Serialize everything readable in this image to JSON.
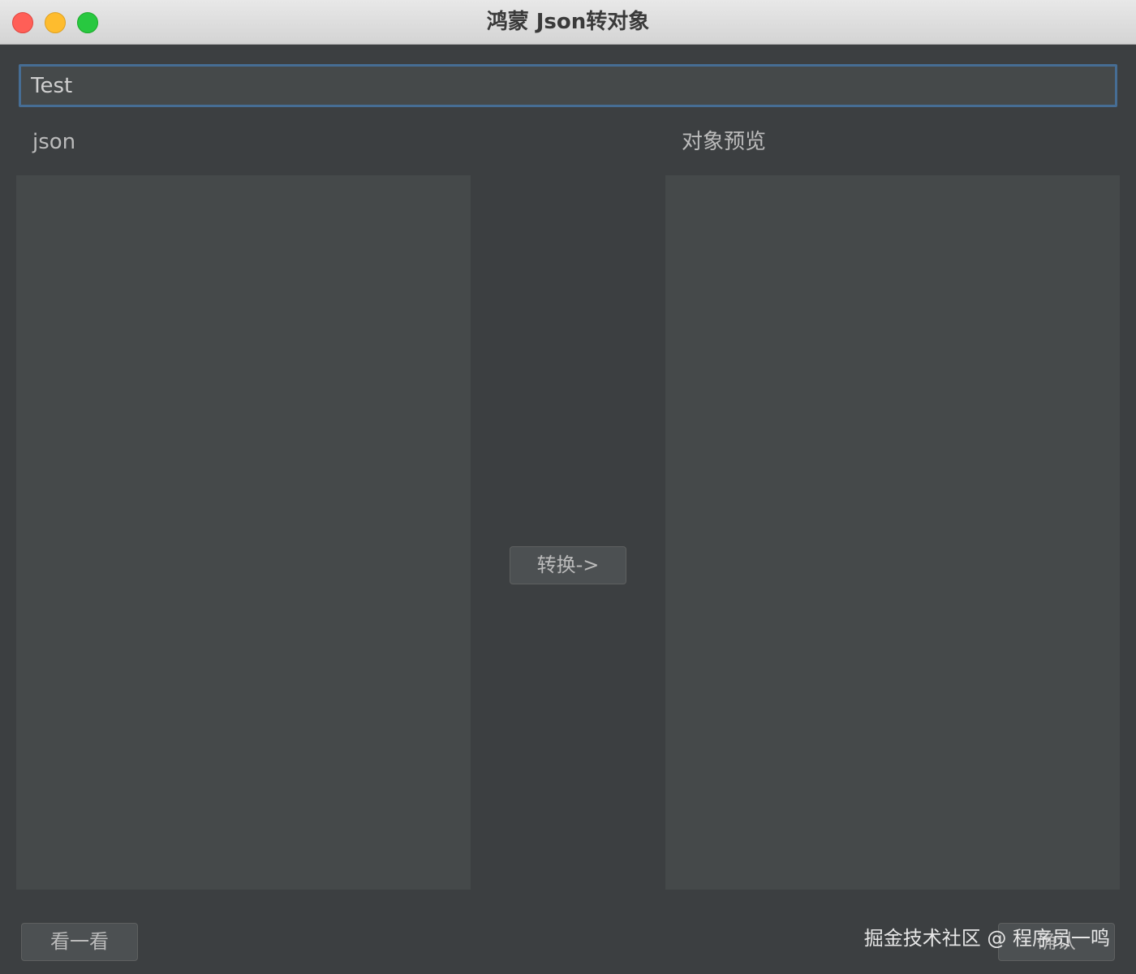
{
  "window": {
    "title": "鸿蒙 Json转对象"
  },
  "form": {
    "name_value": "Test",
    "json_label": "json",
    "json_text": "",
    "preview_label": "对象预览",
    "preview_text": ""
  },
  "buttons": {
    "convert_label": "转换->",
    "look_label": "看一看",
    "confirm_label": "确认"
  },
  "watermark": {
    "text": "掘金技术社区 @ 程序员一鸣"
  },
  "colors": {
    "background": "#3c3f41",
    "field": "#45494a",
    "focus_border": "#466d94",
    "traffic_close": "#ff5f57",
    "traffic_minimize": "#febc2e",
    "traffic_maximize": "#28c840"
  }
}
